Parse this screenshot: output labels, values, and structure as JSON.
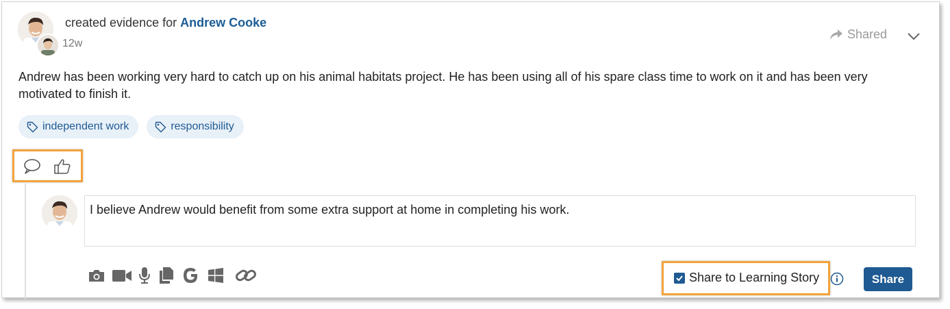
{
  "post": {
    "action_text": "created evidence for",
    "student_name": "Andrew Cooke",
    "time_ago": "12w",
    "status_label": "Shared",
    "body": "Andrew has been working very hard to catch up on his animal habitats project. He has been using all of his spare class time to work on it and has been very motivated to finish it.",
    "tags": [
      {
        "label": "independent work",
        "icon": "tag-icon"
      },
      {
        "label": "responsibility",
        "icon": "tag-icon"
      }
    ]
  },
  "reactions": {
    "comment_icon": "comment-icon",
    "like_icon": "thumbs-up-icon"
  },
  "comment": {
    "text": "I believe Andrew would benefit from some extra support at home in completing his work.",
    "toolbar_icons": [
      "camera-icon",
      "video-icon",
      "microphone-icon",
      "files-icon",
      "google-icon",
      "windows-icon",
      "link-icon"
    ],
    "share_to_story_label": "Share to Learning Story",
    "share_to_story_checked": true,
    "share_button_label": "Share"
  },
  "colors": {
    "accent": "#1f5a92",
    "highlight": "#f2a33a",
    "tag_bg": "#e8f0f8"
  }
}
